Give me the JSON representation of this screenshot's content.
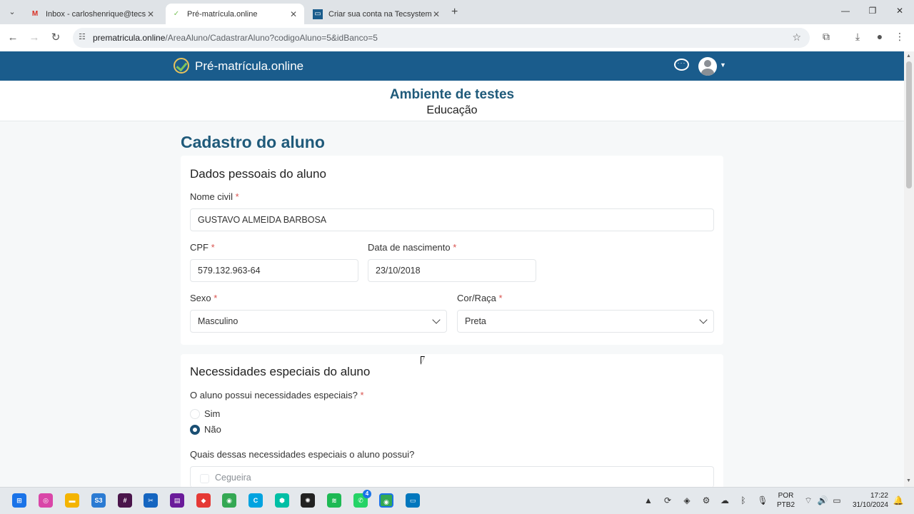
{
  "browser": {
    "tabs": [
      {
        "title": "Inbox - carloshenrique@tecsystem",
        "icon": "gmail-icon"
      },
      {
        "title": "Pré-matrícula.online",
        "icon": "check-icon"
      },
      {
        "title": "Criar sua conta na Tecsystem",
        "icon": "tecsystem-icon"
      }
    ],
    "url_domain": "prematricula.online",
    "url_path": "/AreaAluno/CadastrarAluno?codigoAluno=5&idBanco=5"
  },
  "header": {
    "logo_text": "Pré-matrícula.online"
  },
  "environment": {
    "title": "Ambiente de testes",
    "subtitle": "Educação"
  },
  "page": {
    "title": "Cadastro do aluno"
  },
  "personal": {
    "section_title": "Dados pessoais do aluno",
    "name_label": "Nome civil",
    "name_value": "GUSTAVO ALMEIDA BARBOSA",
    "cpf_label": "CPF",
    "cpf_value": "579.132.963-64",
    "birth_label": "Data de nascimento",
    "birth_value": "23/10/2018",
    "sex_label": "Sexo",
    "sex_value": "Masculino",
    "race_label": "Cor/Raça",
    "race_value": "Preta",
    "required_mark": "*"
  },
  "special_needs": {
    "section_title": "Necessidades especiais do aluno",
    "question": "O aluno possui necessidades especiais?",
    "option_yes": "Sim",
    "option_no": "Não",
    "selected": "Não",
    "which_question": "Quais dessas necessidades especiais o aluno possui?",
    "first_option": "Cegueira"
  },
  "taskbar": {
    "whatsapp_badge": "4",
    "lang_line1": "POR",
    "lang_line2": "PTB2",
    "time": "17:22",
    "date": "31/10/2024"
  },
  "colors": {
    "header_bg": "#1a5c8c",
    "title_color": "#1f5a7a",
    "required": "#d9534f"
  }
}
